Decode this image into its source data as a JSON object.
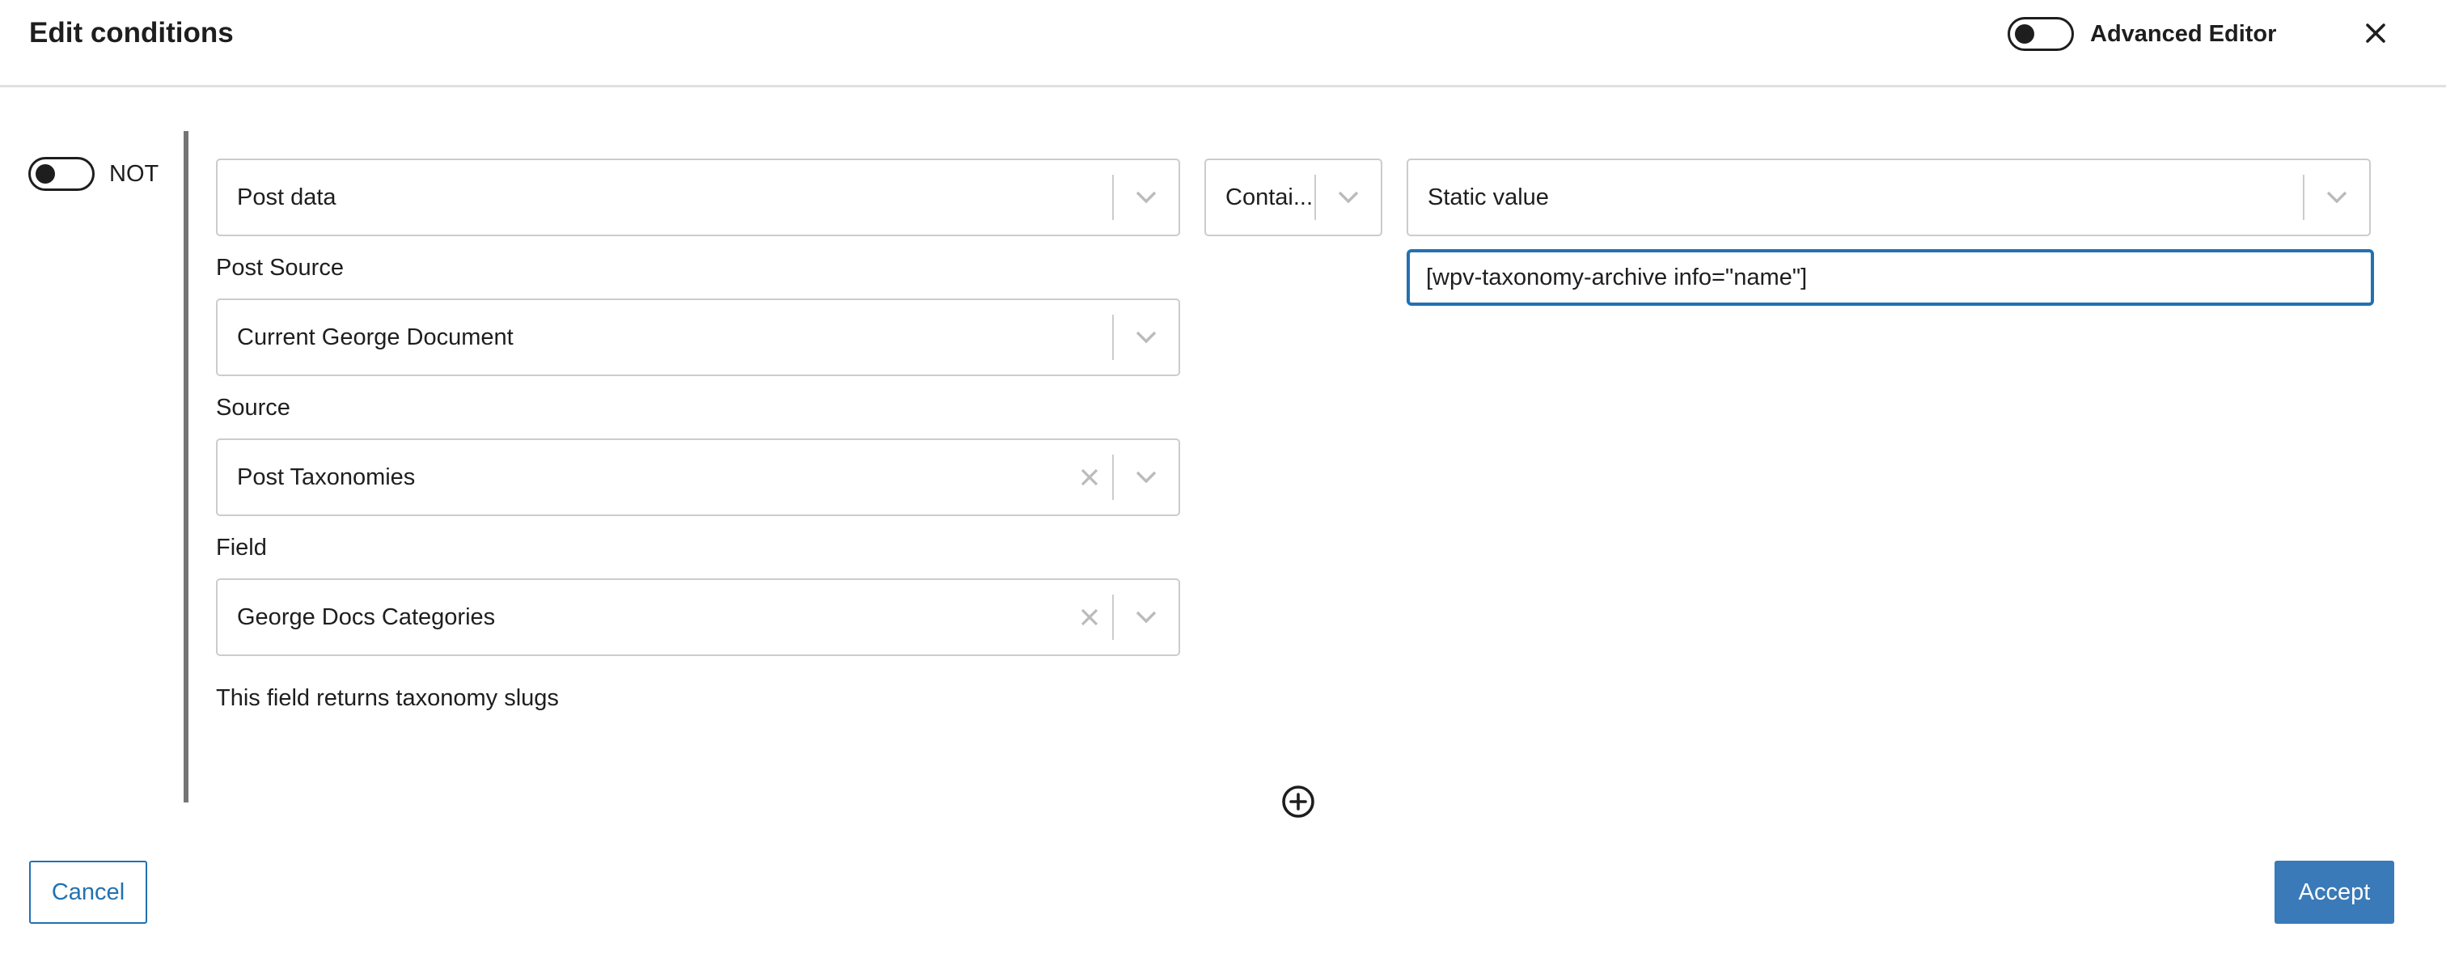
{
  "header": {
    "title": "Edit conditions",
    "advanced_editor_label": "Advanced Editor",
    "advanced_editor_on": false,
    "close_icon": "close-icon"
  },
  "condition": {
    "not_label": "NOT",
    "not_on": false,
    "data_type": {
      "value": "Post data",
      "clearable": false
    },
    "post_source": {
      "label": "Post Source",
      "value": "Current George Document",
      "clearable": false
    },
    "source": {
      "label": "Source",
      "value": "Post Taxonomies",
      "clearable": true
    },
    "field": {
      "label": "Field",
      "value": "George Docs Categories",
      "clearable": true
    },
    "help_text": "This field returns taxonomy slugs",
    "operator": {
      "value": "Contai..."
    },
    "value_type": {
      "value": "Static value"
    },
    "static_value": "[wpv-taxonomy-archive info=\"name\"]"
  },
  "actions": {
    "add_icon": "plus-circle-icon",
    "cancel_label": "Cancel",
    "accept_label": "Accept"
  },
  "colors": {
    "accent": "#2271b1",
    "accept_bg": "#3a7ab8",
    "border": "#cccccc"
  }
}
